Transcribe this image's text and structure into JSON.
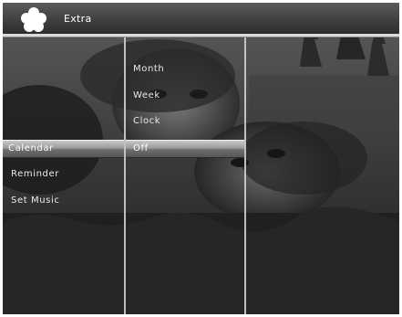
{
  "header": {
    "title": "Extra",
    "logo_icon": "flower-logo-icon"
  },
  "menu": {
    "items": [
      {
        "label": "Calendar",
        "selected": true
      },
      {
        "label": "Reminder",
        "selected": false
      },
      {
        "label": "Set Music",
        "selected": false
      }
    ]
  },
  "submenu": {
    "options": [
      {
        "label": "Month",
        "selected": false
      },
      {
        "label": "Week",
        "selected": false
      },
      {
        "label": "Clock",
        "selected": false
      },
      {
        "label": "Off",
        "selected": true
      }
    ]
  },
  "colors": {
    "selection": "#9a9a9a",
    "text": "#eaeaea",
    "background": "#1a1a1a"
  }
}
